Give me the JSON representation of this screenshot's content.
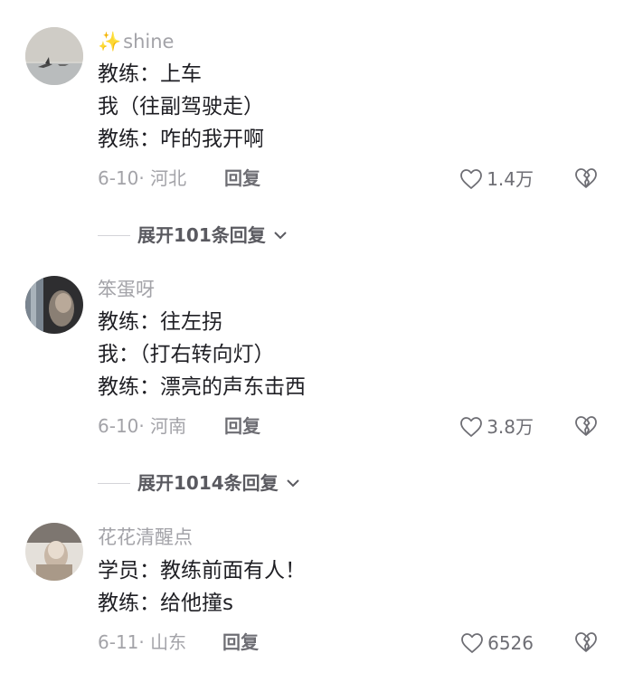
{
  "comments": [
    {
      "username": "shine",
      "username_prefix": "✨",
      "lines": [
        "教练：上车",
        "我（往副驾驶走）",
        "教练：咋的我开啊"
      ],
      "date_location": "6-10· 河北",
      "reply_label": "回复",
      "likes": "1.4万",
      "expand_label": "展开101条回复"
    },
    {
      "username": "笨蛋呀",
      "lines": [
        "教练：往左拐",
        "我：（打右转向灯）",
        "教练：漂亮的声东击西"
      ],
      "date_location": "6-10· 河南",
      "reply_label": "回复",
      "likes": "3.8万",
      "expand_label": "展开1014条回复"
    },
    {
      "username": "花花清醒点",
      "lines": [
        "学员：教练前面有人！",
        "教练：给他撞s"
      ],
      "date_location": "6-11· 山东",
      "reply_label": "回复",
      "likes": "6526"
    }
  ],
  "icons": {
    "heart": "heart-outline-icon",
    "dislike": "broken-heart-icon",
    "chevron": "chevron-down-icon"
  }
}
